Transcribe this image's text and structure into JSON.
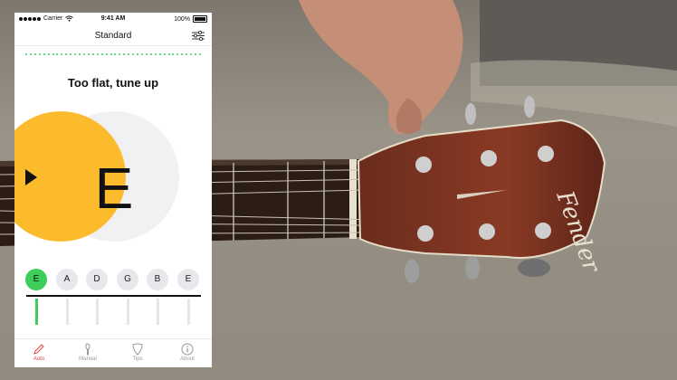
{
  "status_bar": {
    "carrier": "Carrier",
    "time": "9:41 AM",
    "battery": "100%"
  },
  "nav": {
    "title": "Standard",
    "settings_icon": "sliders-icon"
  },
  "tuner": {
    "message": "Too flat, tune up",
    "note": "E",
    "direction_icon": "play-triangle-icon",
    "accent_color": "#fbbb2d",
    "in_tune_color": "#3ecc5a"
  },
  "strings": [
    {
      "note": "E",
      "active": true
    },
    {
      "note": "A",
      "active": false
    },
    {
      "note": "D",
      "active": false
    },
    {
      "note": "G",
      "active": false
    },
    {
      "note": "B",
      "active": false
    },
    {
      "note": "E",
      "active": false
    }
  ],
  "tabs": [
    {
      "label": "Auto",
      "icon": "pencil-icon",
      "active": true
    },
    {
      "label": "Manual",
      "icon": "tuning-peg-icon",
      "active": false
    },
    {
      "label": "Tips",
      "icon": "guitar-pick-icon",
      "active": false
    },
    {
      "label": "About",
      "icon": "info-icon",
      "active": false
    }
  ]
}
